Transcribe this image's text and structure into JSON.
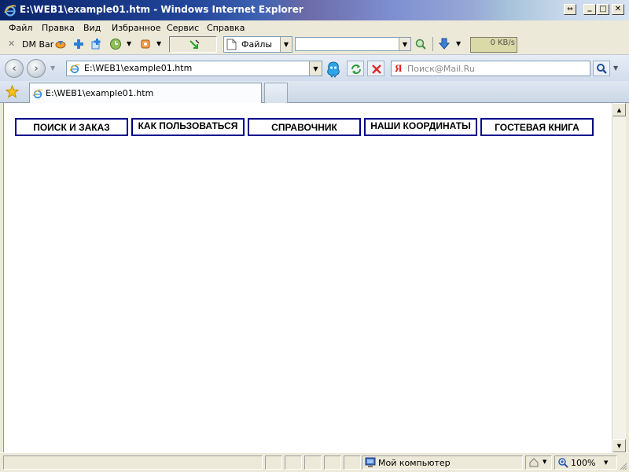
{
  "window": {
    "title": "E:\\WEB1\\example01.htm - Windows Internet Explorer",
    "restore_glyph": "⇔",
    "minimize_glyph": "_",
    "maximize_glyph": "□",
    "close_glyph": "✕"
  },
  "menu": {
    "items": [
      "Файл",
      "Правка",
      "Вид",
      "Избранное",
      "Сервис",
      "Справка"
    ]
  },
  "toolbar": {
    "dm_bar_label": "DM Bar",
    "files_label": "Файлы",
    "search_combo_value": "",
    "speed_label": "0 KB/s"
  },
  "address": {
    "url": "E:\\WEB1\\example01.htm",
    "search_placeholder": "Поиск@Mail.Ru"
  },
  "tabs": {
    "active_title": "E:\\WEB1\\example01.htm"
  },
  "page": {
    "nav_links": [
      "ПОИСК И ЗАКАЗ",
      "КАК ПОЛЬЗОВАТЬСЯ",
      "СПРАВОЧНИК",
      "НАШИ КООРДИНАТЫ",
      "ГОСТЕВАЯ КНИГА"
    ],
    "link_border_color": "#00008b"
  },
  "status": {
    "zone": "Мой компьютер",
    "zoom": "100%"
  },
  "icons": {
    "title": "ie-logo-icon",
    "nav": [
      "back-icon",
      "forward-icon",
      "refresh-icon",
      "stop-icon"
    ],
    "search": "search-go-icon"
  }
}
